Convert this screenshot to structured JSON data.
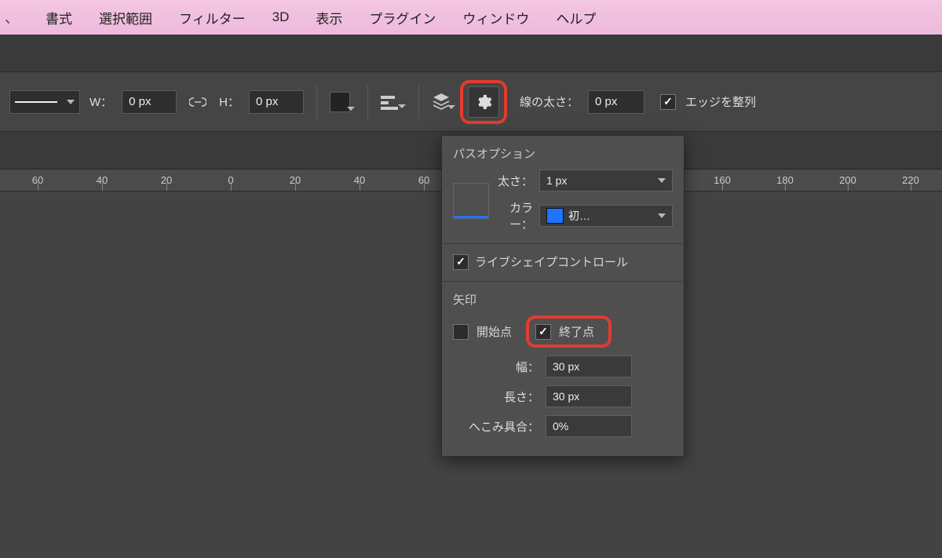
{
  "menubar": {
    "items": [
      "書式",
      "選択範囲",
      "フィルター",
      "3D",
      "表示",
      "プラグイン",
      "ウィンドウ",
      "ヘルプ"
    ]
  },
  "optionbar": {
    "width_label": "W：",
    "width_value": "0 px",
    "height_label": "H：",
    "height_value": "0 px",
    "stroke_label": "線の太さ：",
    "stroke_value": "0 px",
    "align_edges_label": "エッジを整列",
    "align_edges_checked": true
  },
  "ruler": {
    "ticks": [
      {
        "pos": 48,
        "label": "60"
      },
      {
        "pos": 130,
        "label": "40"
      },
      {
        "pos": 212,
        "label": "20"
      },
      {
        "pos": 294,
        "label": "0"
      },
      {
        "pos": 376,
        "label": "20"
      },
      {
        "pos": 458,
        "label": "40"
      },
      {
        "pos": 540,
        "label": "60"
      },
      {
        "pos": 920,
        "label": "160"
      },
      {
        "pos": 1000,
        "label": "180"
      },
      {
        "pos": 1080,
        "label": "200"
      },
      {
        "pos": 1160,
        "label": "220"
      }
    ]
  },
  "panel": {
    "path_options_title": "パスオプション",
    "thickness_label": "太さ：",
    "thickness_value": "1 px",
    "color_label": "カラー：",
    "color_value": "初…",
    "live_shape_label": "ライブシェイプコントロール",
    "live_shape_checked": true,
    "arrow_title": "矢印",
    "start_label": "開始点",
    "start_checked": false,
    "end_label": "終了点",
    "end_checked": true,
    "width_label": "幅：",
    "width_value": "30 px",
    "length_label": "長さ：",
    "length_value": "30 px",
    "concavity_label": "へこみ具合：",
    "concavity_value": "0%"
  }
}
